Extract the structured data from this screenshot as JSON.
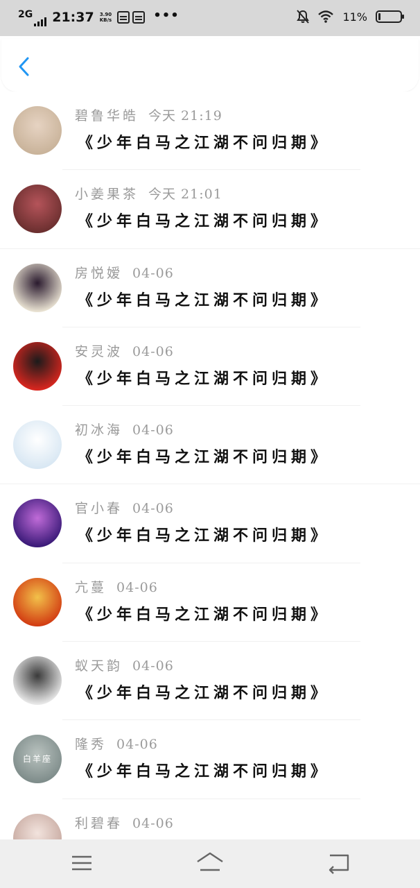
{
  "status_bar": {
    "network": "2G",
    "time": "21:37",
    "speed_value": "3.90",
    "speed_unit": "KB/s",
    "more": "•••",
    "battery_pct": "11%",
    "battery_level": 0.11,
    "icons": [
      "signal-icon",
      "sim-card-icon",
      "sim-card-icon",
      "mute-icon",
      "wifi-icon",
      "battery-icon"
    ]
  },
  "header": {
    "back_icon": "chevron-left-icon",
    "accent": "#2196f3"
  },
  "list": {
    "items": [
      {
        "name": "碧鲁华皓",
        "time": "今天 21:19",
        "message": "《少年白马之江湖不问归期》",
        "avatar_colors": [
          "#c9b39a",
          "#e6d3c2"
        ]
      },
      {
        "name": "小姜果茶",
        "time": "今天 21:01",
        "message": "《少年白马之江湖不问归期》",
        "avatar_colors": [
          "#6b2f2f",
          "#b5545a"
        ]
      },
      {
        "name": "房悦嫒",
        "time": "04-06",
        "message": "《少年白马之江湖不问归期》",
        "avatar_colors": [
          "#e9e2d2",
          "#2a1a2e"
        ]
      },
      {
        "name": "安灵波",
        "time": "04-06",
        "message": "《少年白马之江湖不问归期》",
        "avatar_colors": [
          "#d9261f",
          "#1b1b1b"
        ]
      },
      {
        "name": "初冰海",
        "time": "04-06",
        "message": "《少年白马之江湖不问归期》",
        "avatar_colors": [
          "#d8e7f3",
          "#ffffff"
        ]
      },
      {
        "name": "官小春",
        "time": "04-06",
        "message": "《少年白马之江湖不问归期》",
        "avatar_colors": [
          "#3a1a78",
          "#c06bd8"
        ]
      },
      {
        "name": "亢蔓",
        "time": "04-06",
        "message": "《少年白马之江湖不问归期》",
        "avatar_colors": [
          "#d23c12",
          "#f2c14a"
        ]
      },
      {
        "name": "蚁天韵",
        "time": "04-06",
        "message": "《少年白马之江湖不问归期》",
        "avatar_colors": [
          "#e8e8e8",
          "#3a3a3a"
        ]
      },
      {
        "name": "隆秀",
        "time": "04-06",
        "message": "《少年白马之江湖不问归期》",
        "avatar_colors": [
          "#7e8c8a",
          "#b9c2bf"
        ],
        "avatar_text": "白羊座"
      },
      {
        "name": "利碧春",
        "time": "04-06",
        "message": "",
        "avatar_colors": [
          "#c7a9a0",
          "#f2e3dd"
        ]
      }
    ]
  },
  "bottom_nav": {
    "icons": [
      "menu-icon",
      "home-icon",
      "back-icon"
    ]
  }
}
